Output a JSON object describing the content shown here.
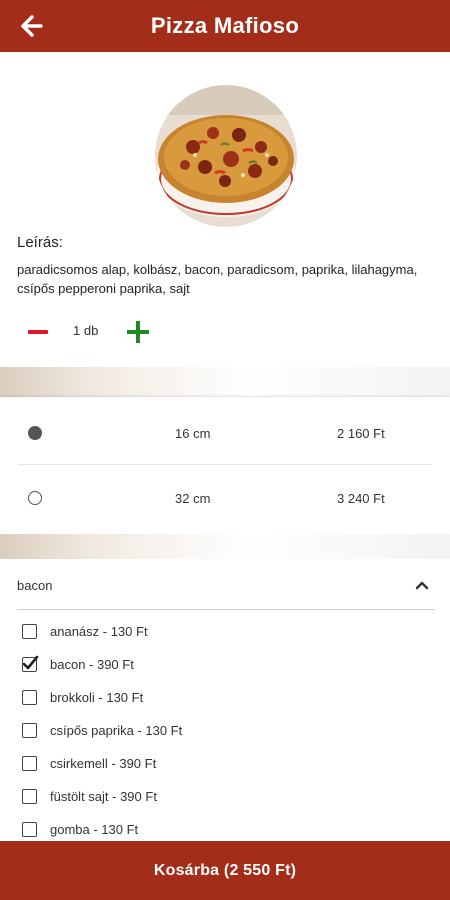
{
  "header": {
    "title": "Pizza Mafioso",
    "back_icon": "arrow-left-icon"
  },
  "product": {
    "image": "pizza-photo",
    "description_title": "Leírás:",
    "description": "paradicsomos alap, kolbász, bacon, paradicsom, paprika, lilahagyma, csípős pepperoni paprika, sajt"
  },
  "quantity": {
    "value": "1 db",
    "minus_icon": "minus-icon",
    "plus_icon": "plus-icon",
    "minus_color": "#e0162b",
    "plus_color": "#1f8a1f"
  },
  "sizes": [
    {
      "size": "16 cm",
      "price": "2 160 Ft",
      "selected": true
    },
    {
      "size": "32 cm",
      "price": "3 240 Ft",
      "selected": false
    }
  ],
  "toppings": {
    "selected_label": "bacon",
    "items": [
      {
        "label": "ananász - 130 Ft",
        "checked": false
      },
      {
        "label": "bacon - 390 Ft",
        "checked": true
      },
      {
        "label": "brokkoli - 130 Ft",
        "checked": false
      },
      {
        "label": "csípős paprika - 130 Ft",
        "checked": false
      },
      {
        "label": "csirkemell - 390 Ft",
        "checked": false
      },
      {
        "label": "füstölt sajt - 390 Ft",
        "checked": false
      },
      {
        "label": "gomba - 130 Ft",
        "checked": false
      }
    ]
  },
  "cart_button": {
    "label": "Kosárba (2 550 Ft)"
  },
  "colors": {
    "brand": "#a42d1a"
  }
}
